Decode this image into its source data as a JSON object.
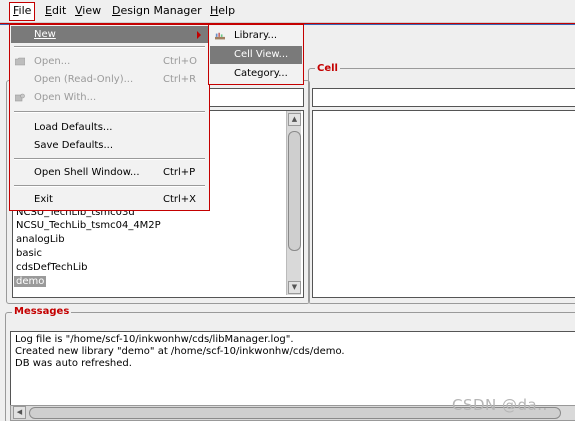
{
  "menubar": {
    "items": [
      {
        "label": "File",
        "u": "F"
      },
      {
        "label": "Edit",
        "u": "E"
      },
      {
        "label": "View",
        "u": "V"
      },
      {
        "label": "Design Manager",
        "u": "D"
      },
      {
        "label": "Help",
        "u": "H"
      }
    ]
  },
  "file_menu": {
    "new": "New",
    "open": "Open...",
    "open_accel": "Ctrl+O",
    "open_readonly": "Open (Read-Only)...",
    "open_readonly_accel": "Ctrl+R",
    "open_with": "Open With...",
    "load_defaults": "Load Defaults...",
    "save_defaults": "Save Defaults...",
    "open_shell": "Open Shell Window...",
    "open_shell_accel": "Ctrl+P",
    "exit": "Exit",
    "exit_accel": "Ctrl+X"
  },
  "new_submenu": {
    "library": "Library...",
    "cell_view": "Cell View...",
    "category": "Category..."
  },
  "cell_group": {
    "title": "Cell"
  },
  "library_list": {
    "items": [
      "NCSU_TechLib_tsmc03d",
      "NCSU_TechLib_tsmc04_4M2P",
      "analogLib",
      "basic",
      "cdsDefTechLib",
      "demo"
    ],
    "selected": "demo"
  },
  "messages": {
    "title": "Messages",
    "lines": [
      "Log file is \"/home/scf-10/inkwonhw/cds/libManager.log\".",
      "Created new library \"demo\" at /home/scf-10/inkwonhw/cds/demo.",
      "DB was auto refreshed."
    ]
  },
  "watermark": "CSDN @da..",
  "colors": {
    "accent_red": "#c40000",
    "highlight": "#7a7a7a",
    "window_bg": "#efefef"
  }
}
